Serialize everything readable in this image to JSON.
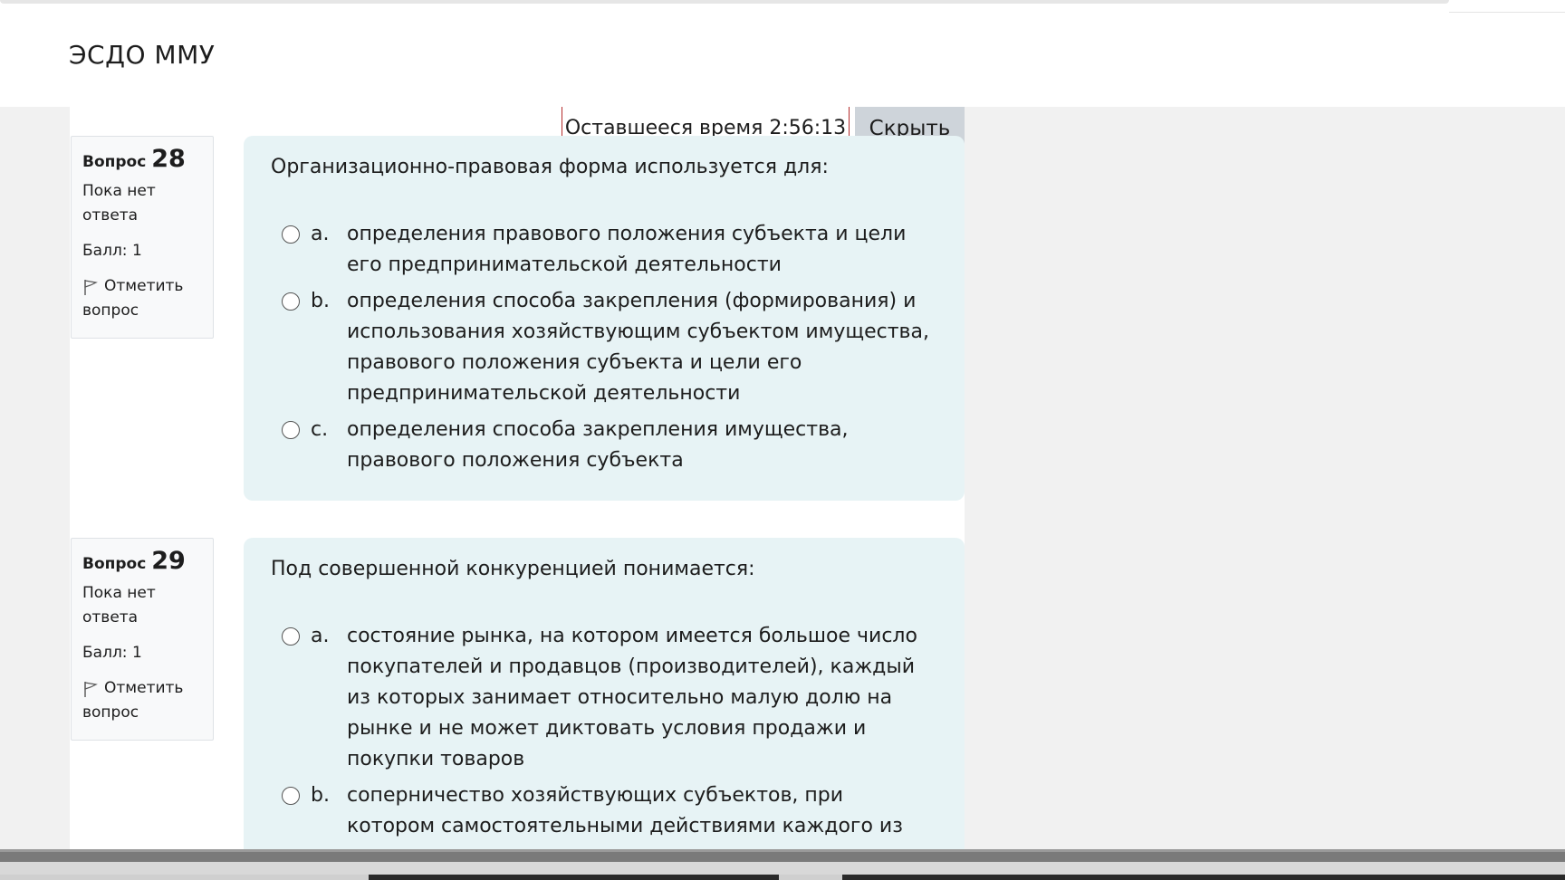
{
  "header": {
    "site_title": "ЭСДО ММУ"
  },
  "timer": {
    "label": "Оставшееся время 2:56:13",
    "hide_label": "Скрыть"
  },
  "questions": [
    {
      "head_label": "Вопрос",
      "number": "28",
      "status": "Пока нет ответа",
      "mark": "Балл: 1",
      "flag_label_1": "Отметить",
      "flag_label_2": "вопрос",
      "text": "Организационно-правовая форма используется для:",
      "answers": [
        {
          "letter": "a.",
          "text": "определения правового положения субъекта и цели его предпринимательской деятельности"
        },
        {
          "letter": "b.",
          "text": "определения способа закрепления (формирования) и использования хозяйствующим субъектом имущества, правового положения субъекта и цели его предпринимательской деятельности"
        },
        {
          "letter": "c.",
          "text": "определения способа закрепления имущества, правового положения субъекта"
        }
      ]
    },
    {
      "head_label": "Вопрос",
      "number": "29",
      "status": "Пока нет ответа",
      "mark": "Балл: 1",
      "flag_label_1": "Отметить",
      "flag_label_2": "вопрос",
      "text": "Под совершенной конкуренцией понимается:",
      "answers": [
        {
          "letter": "a.",
          "text": "состояние рынка, на котором имеется большое число покупателей и продавцов (производителей), каждый из которых занимает относительно малую долю на рынке и не может диктовать условия продажи и покупки товаров"
        },
        {
          "letter": "b.",
          "text": "соперничество хозяйствующих субъектов, при котором самостоятельными действиями каждого из них исключается или ограничивается возможность каждого"
        }
      ]
    }
  ]
}
